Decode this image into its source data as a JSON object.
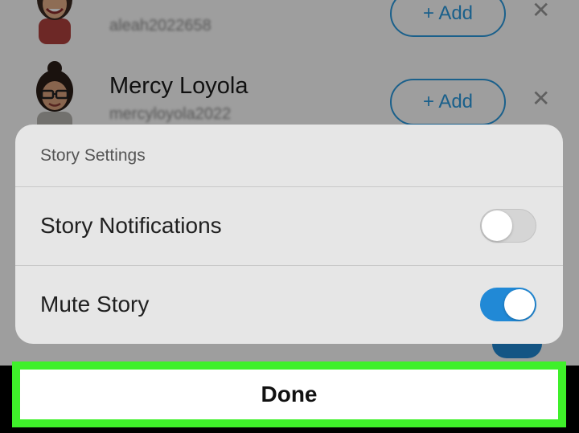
{
  "friends": [
    {
      "name": "",
      "username": "aleah2022658",
      "add_label": "+ Add",
      "remove_glyph": "✕"
    },
    {
      "name": "Mercy Loyola",
      "username": "mercyloyola2022",
      "add_label": "+ Add",
      "remove_glyph": "✕"
    }
  ],
  "story_settings": {
    "title": "Story Settings",
    "rows": [
      {
        "label": "Story Notifications",
        "enabled": false
      },
      {
        "label": "Mute Story",
        "enabled": true
      }
    ]
  },
  "done_label": "Done",
  "colors": {
    "accent_blue": "#2189d6",
    "highlight_green": "#3ff02a"
  }
}
